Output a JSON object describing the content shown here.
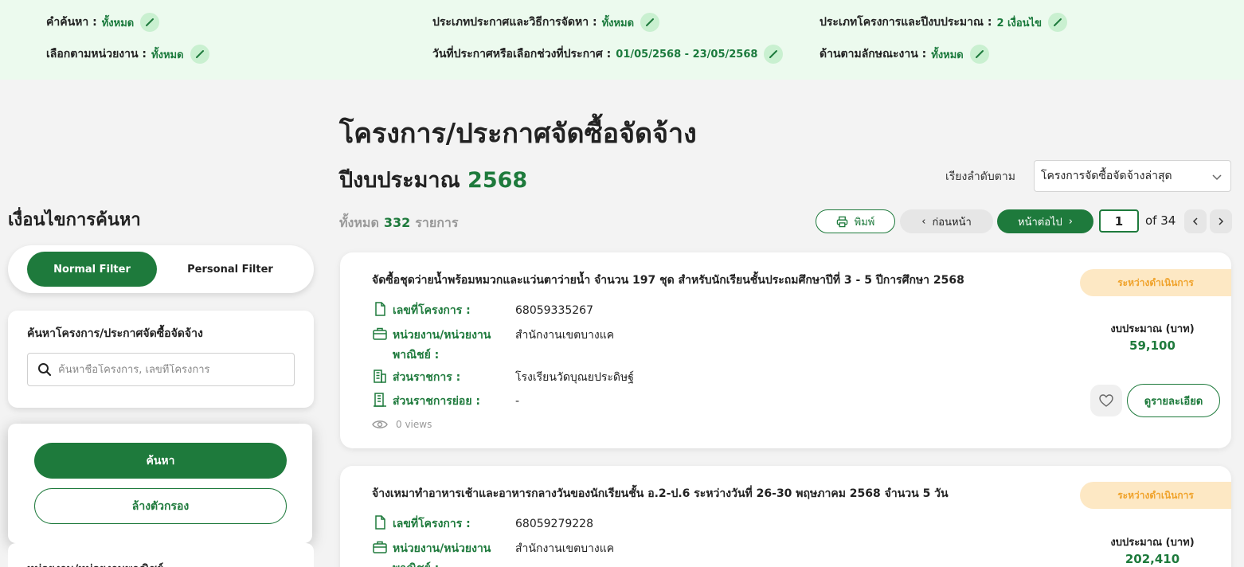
{
  "filters": {
    "keyword": {
      "label": "คำค้นหา :",
      "value": "ทั้งหมด"
    },
    "announce_type": {
      "label": "ประเภทประกาศและวิธีการจัดหา :",
      "value": "ทั้งหมด"
    },
    "project_type": {
      "label": "ประเภทโครงการและปีงบประมาณ :",
      "value": "2 เงื่อนไข"
    },
    "agency": {
      "label": "เลือกตามหน่วยงาน :",
      "value": "ทั้งหมด"
    },
    "date_range": {
      "label": "วันที่ประกาศหรือเลือกช่วงที่ประกาศ :",
      "value": "01/05/2568 - 23/05/2568"
    },
    "work_nature": {
      "label": "ด้านตามลักษณะงาน :",
      "value": "ทั้งหมด"
    }
  },
  "sidebar": {
    "title": "เงื่อนไขการค้นหา",
    "normal_filter": "Normal Filter",
    "personal_filter": "Personal Filter",
    "search_title": "ค้นหาโครงการ/ประกาศจัดซื้อจัดจ้าง",
    "search_placeholder": "ค้นหาชื่อโครงการ, เลขที่โครงการ",
    "search_button": "ค้นหา",
    "clear_button": "ล้างตัวกรอง",
    "next_section": "หน่วยงาน/หน่วยงานพาณิชย์"
  },
  "main": {
    "title": "โครงการ/ประกาศจัดซื้อจัดจ้าง",
    "budget_label": "ปีงบประมาณ",
    "budget_year": "2568",
    "sort_label": "เรียงลำดับตาม",
    "sort_value": "โครงการจัดซื้อจัดจ้างล่าสุด",
    "count_prefix": "ทั้งหมด",
    "count": "332",
    "count_suffix": "รายการ"
  },
  "pagination": {
    "print": "พิมพ์",
    "prev": "ก่อนหน้า",
    "next": "หน้าต่อไป",
    "current_page": "1",
    "of_label": "of 34"
  },
  "labels": {
    "project_no": "เลขที่โครงการ :",
    "agency": "หน่วยงาน/หน่วยงาน พาณิชย์ :",
    "department": "ส่วนราชการ :",
    "sub_department": "ส่วนราชการย่อย :",
    "budget": "งบประมาณ (บาท)",
    "detail_button": "ดูรายละเอียด"
  },
  "projects": [
    {
      "title": "จัดซื้อชุดว่ายน้ำพร้อมหมวกและแว่นตาว่ายน้ำ จำนวน 197 ชุด สำหรับนักเรียนชั้นประถมศึกษาปีที่ 3 - 5 ปีการศึกษา 2568",
      "status": "ระหว่างดำเนินการ",
      "project_no": "68059335267",
      "agency": "สำนักงานเขตบางแค",
      "department": "โรงเรียนวัดบุณยประดิษฐ์",
      "sub_department": "-",
      "views": "0 views",
      "budget": "59,100"
    },
    {
      "title": "จ้างเหมาทำอาหารเช้าและอาหารกลางวันของนักเรียนชั้น อ.2-ป.6 ระหว่างวันที่ 26-30 พฤษภาคม 2568 จำนวน 5 วัน",
      "status": "ระหว่างดำเนินการ",
      "project_no": "68059279228",
      "agency": "สำนักงานเขตบางแค",
      "budget": "202,410"
    }
  ],
  "colors": {
    "primary_green": "#1e7a3c",
    "status_bg": "#fde8c4",
    "status_text": "#f0a32c",
    "topbar_bg": "#ecfaee"
  }
}
